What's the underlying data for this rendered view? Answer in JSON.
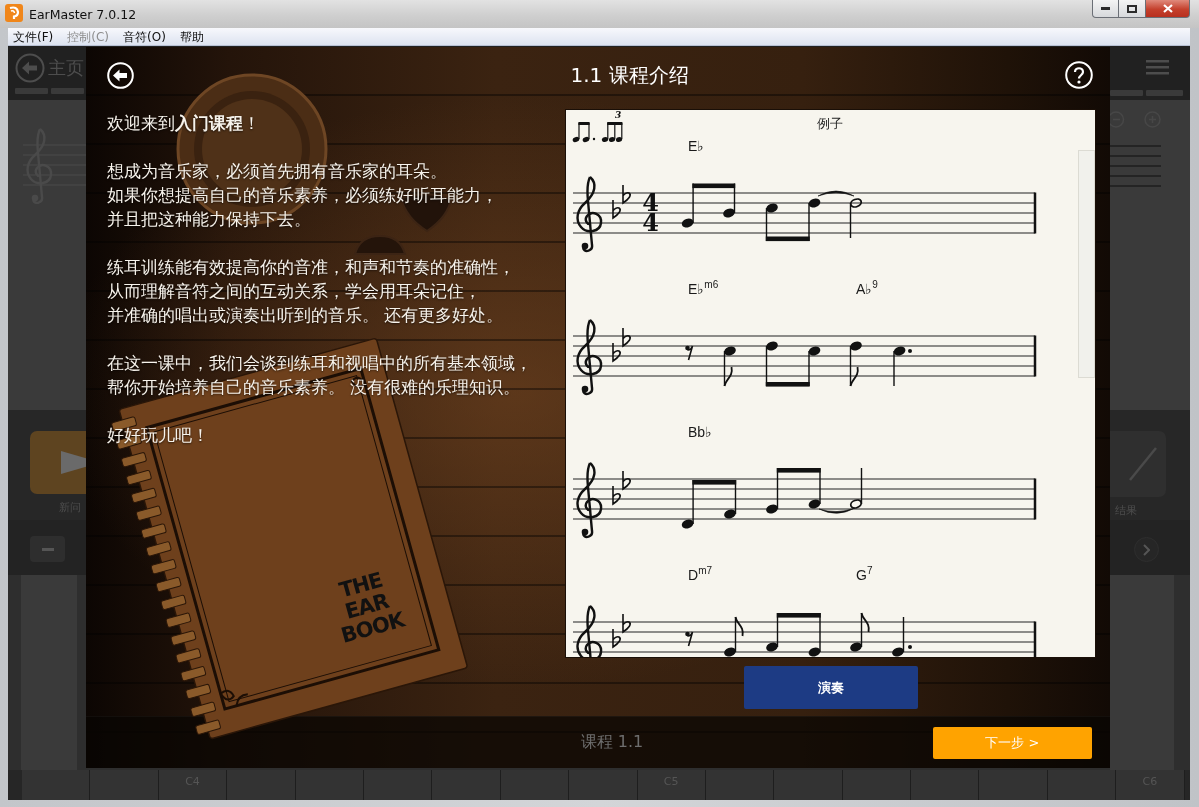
{
  "window": {
    "title": "EarMaster 7.0.12"
  },
  "menu": [
    {
      "label": "文件(F)",
      "disabled": false
    },
    {
      "label": "控制(C)",
      "disabled": true
    },
    {
      "label": "音符(O)",
      "disabled": false
    },
    {
      "label": "帮助",
      "disabled": false
    }
  ],
  "background_app": {
    "home_label": "主页",
    "new_question_label": "新问",
    "result_label": "结果",
    "piano_key_labels": [
      "C4",
      "C5",
      "C6"
    ]
  },
  "lesson_dialog": {
    "title": "1.1 课程介绍",
    "intro": [
      {
        "lines": [
          "欢迎来到**入门课程**！"
        ]
      },
      {
        "lines": [
          "想成为音乐家，必须首先拥有音乐家的耳朵。",
          "如果你想提高自己的音乐素养，必须练好听耳能力，",
          "并且把这种能力保持下去。"
        ]
      },
      {
        "lines": [
          "练耳训练能有效提高你的音准，和声和节奏的准确性，",
          "从而理解音符之间的互动关系，学会用耳朵记住，",
          "并准确的唱出或演奏出听到的音乐。 还有更多好处。"
        ]
      },
      {
        "lines": [
          "在这一课中，我们会谈到练耳和视唱中的所有基本领域，",
          "帮你开始培养自己的音乐素养。 没有很难的乐理知识。"
        ]
      },
      {
        "lines": [
          "好好玩儿吧！"
        ]
      }
    ],
    "notebook_title": [
      "THE",
      "EAR",
      "BOOK"
    ],
    "sheet": {
      "title": "例子",
      "triplet_mark": "3",
      "time_signature": [
        "4",
        "4"
      ],
      "systems": [
        {
          "chords": [
            "E♭"
          ]
        },
        {
          "chords": [
            "E♭$^{m6}$",
            "A♭$^{9}$"
          ]
        },
        {
          "chords": [
            "Bb♭"
          ]
        },
        {
          "chords": [
            "D$^{m7}$",
            "G$^{7}$"
          ]
        }
      ]
    },
    "play_button": "演奏",
    "footer_label": "课程 1.1",
    "next_button": "下一步 >"
  }
}
